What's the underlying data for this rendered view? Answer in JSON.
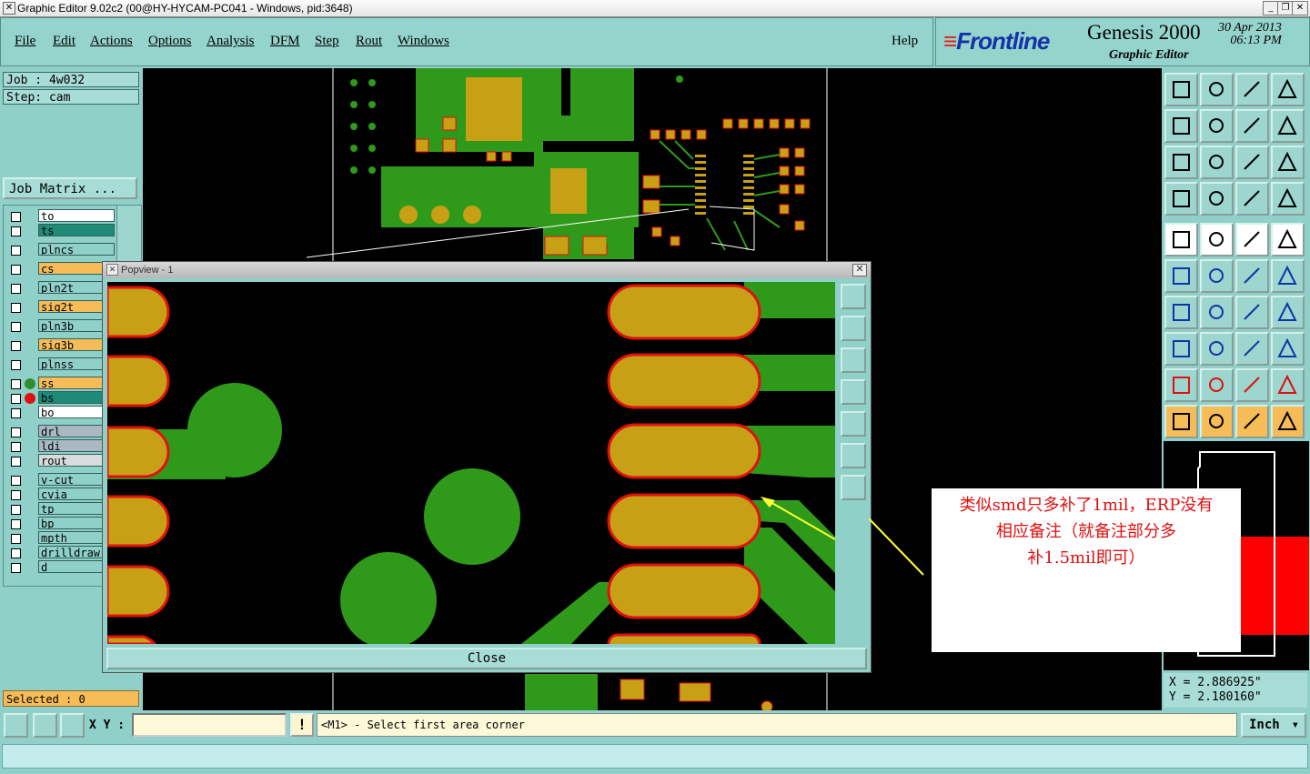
{
  "window": {
    "title": "Graphic Editor 9.02c2 (00@HY-HYCAM-PC041 - Windows, pid:3648)"
  },
  "menu": {
    "items": [
      "File",
      "Edit",
      "Actions",
      "Options",
      "Analysis",
      "DFM",
      "Step",
      "Rout",
      "Windows"
    ],
    "help": "Help"
  },
  "brand": {
    "logo": "Frontline",
    "product": "Genesis 2000",
    "subtitle": "Graphic Editor",
    "date": "30 Apr 2013",
    "time": "06:13 PM"
  },
  "job": {
    "job_label": "Job : 4w032",
    "step_label": "Step: cam",
    "matrix_button": "Job Matrix ..."
  },
  "layers": [
    {
      "name": "to",
      "color": "#ffffff"
    },
    {
      "name": "ts",
      "color": "#1f8a78"
    },
    {
      "name": "plncs",
      "color": "#8fd0c8"
    },
    {
      "name": "cs",
      "color": "#f5bc57"
    },
    {
      "name": "pln2t",
      "color": "#8fd0c8"
    },
    {
      "name": "sig2t",
      "color": "#f5bc57"
    },
    {
      "name": "pln3b",
      "color": "#8fd0c8"
    },
    {
      "name": "sig3b",
      "color": "#f5bc57"
    },
    {
      "name": "plnss",
      "color": "#8fd0c8"
    },
    {
      "name": "ss",
      "color": "#f5bc57",
      "dot": "#2f8f2f"
    },
    {
      "name": "bs",
      "color": "#1f8a78",
      "dot": "#e01010"
    },
    {
      "name": "bo",
      "color": "#ffffff"
    },
    {
      "name": "drl",
      "color": "#a9b8c2"
    },
    {
      "name": "ldi",
      "color": "#a9b8c2"
    },
    {
      "name": "rout",
      "color": "#d9dcdc"
    },
    {
      "name": "v-cut",
      "color": "#8fd0c8"
    },
    {
      "name": "cvia",
      "color": "#8fd0c8"
    },
    {
      "name": "tp",
      "color": "#8fd0c8"
    },
    {
      "name": "bp",
      "color": "#8fd0c8"
    },
    {
      "name": "mpth",
      "color": "#8fd0c8"
    },
    {
      "name": "drilldraw.",
      "color": "#8fd0c8"
    },
    {
      "name": "d",
      "color": "#8fd0c8"
    }
  ],
  "selected_label": "Selected : 0",
  "popup": {
    "title": "Popview - 1",
    "close_label": "Close"
  },
  "annotation": {
    "lines": [
      "类似smd只多补了1mil，ERP没有",
      "相应备注（就备注部分多",
      "补1.5mil即可）"
    ]
  },
  "coords": {
    "x": "X = 2.886925\"",
    "y": "Y = 2.180160\""
  },
  "bottom": {
    "xy_label": "X Y :",
    "xy_value": "",
    "prompt": "<M1> - Select first area corner",
    "units": "Inch",
    "exclaim": "!"
  },
  "colors": {
    "panel": "#8fd0c8",
    "copper": "#2f9a1a",
    "pad": "#c8a015",
    "pad_edge": "#e01010",
    "annotation": "#e01010",
    "arrow": "#ffff33"
  }
}
